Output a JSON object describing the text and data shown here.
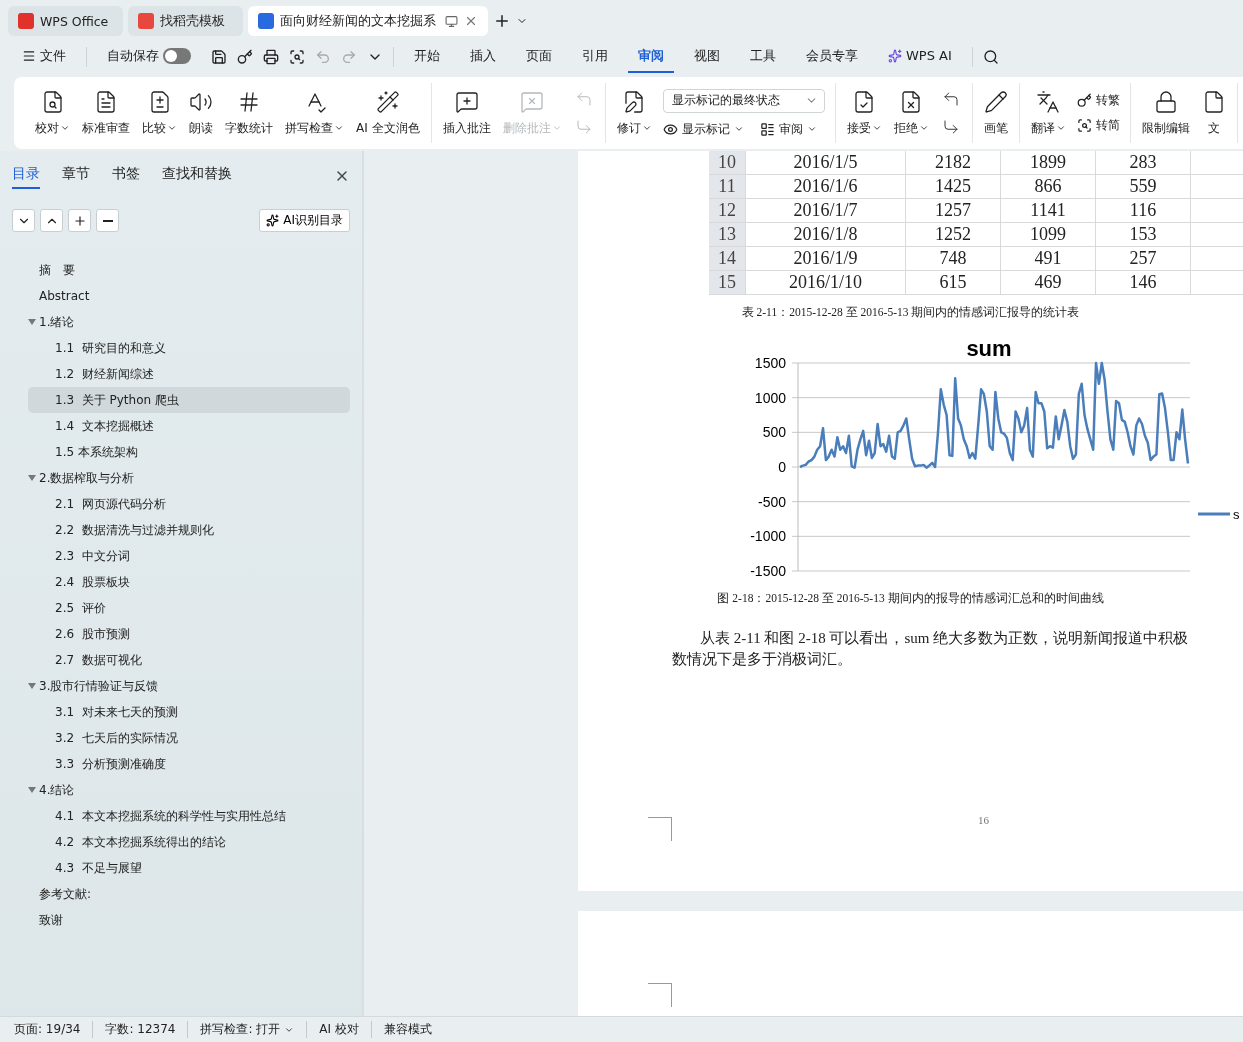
{
  "tabs": [
    {
      "kind": "wps",
      "label": "WPS Office",
      "selected": false
    },
    {
      "kind": "docer",
      "label": "找稻壳模板",
      "selected": false
    },
    {
      "kind": "doc",
      "label": "面向财经新闻的文本挖掘系",
      "selected": true
    }
  ],
  "menu": {
    "file": "文件",
    "autosave": {
      "label": "自动保存",
      "on": false
    },
    "items": [
      {
        "label": "开始",
        "selected": false
      },
      {
        "label": "插入",
        "selected": false
      },
      {
        "label": "页面",
        "selected": false
      },
      {
        "label": "引用",
        "selected": false
      },
      {
        "label": "审阅",
        "selected": true
      },
      {
        "label": "视图",
        "selected": false
      },
      {
        "label": "工具",
        "selected": false
      },
      {
        "label": "会员专享",
        "selected": false
      },
      {
        "label": "WPS AI",
        "selected": false,
        "kind": "ai"
      }
    ]
  },
  "ribbon": [
    {
      "items": [
        {
          "kind": "large",
          "label": "校对",
          "dropdown": true,
          "disabled": false
        },
        {
          "kind": "large",
          "label": "标准审查",
          "dropdown": false,
          "disabled": false
        },
        {
          "kind": "large",
          "label": "比较",
          "dropdown": true,
          "disabled": false
        },
        {
          "kind": "large",
          "label": "朗读",
          "dropdown": false,
          "disabled": false
        },
        {
          "kind": "large",
          "label": "字数统计",
          "dropdown": false,
          "disabled": false
        },
        {
          "kind": "large",
          "label": "拼写检查",
          "dropdown": true,
          "disabled": false
        },
        {
          "kind": "large",
          "label": "AI 全文润色",
          "dropdown": false,
          "disabled": false
        }
      ]
    },
    {
      "items": [
        {
          "kind": "large",
          "label": "插入批注",
          "dropdown": false,
          "disabled": false
        },
        {
          "kind": "large",
          "label": "删除批注",
          "dropdown": true,
          "disabled": true
        },
        {
          "kind": "pair",
          "disabled": true
        }
      ]
    },
    {
      "items": [
        {
          "kind": "large",
          "label": "修订",
          "dropdown": true,
          "disabled": false
        },
        {
          "kind": "select",
          "value": "显示标记的最终状态",
          "buttons": [
            {
              "label": "显示标记",
              "dropdown": true
            },
            {
              "label": "审阅",
              "dropdown": true
            }
          ]
        }
      ]
    },
    {
      "items": [
        {
          "kind": "large",
          "label": "接受",
          "dropdown": true,
          "disabled": false
        },
        {
          "kind": "large",
          "label": "拒绝",
          "dropdown": true,
          "disabled": false
        },
        {
          "kind": "pair",
          "disabled": false
        }
      ]
    },
    {
      "items": [
        {
          "kind": "large",
          "label": "画笔",
          "dropdown": false,
          "disabled": false
        }
      ]
    },
    {
      "items": [
        {
          "kind": "large",
          "label": "翻译",
          "dropdown": true,
          "disabled": false
        },
        {
          "kind": "stack",
          "buttons": [
            {
              "label": "转繁",
              "dropdown": false
            },
            {
              "label": "转简",
              "dropdown": false
            }
          ]
        }
      ]
    },
    {
      "items": [
        {
          "kind": "large",
          "label": "限制编辑",
          "dropdown": false,
          "disabled": false
        },
        {
          "kind": "large",
          "label": "文",
          "dropdown": false,
          "disabled": false
        }
      ]
    }
  ],
  "sidebar": {
    "tabs": [
      {
        "label": "目录",
        "selected": true
      },
      {
        "label": "章节",
        "selected": false
      },
      {
        "label": "书签",
        "selected": false
      },
      {
        "label": "查找和替换",
        "selected": false
      }
    ],
    "ai_button": "AI识别目录",
    "outline": [
      {
        "label": "摘　要",
        "selected": false
      },
      {
        "label": "Abstract",
        "selected": false
      },
      {
        "label": "1.绪论",
        "selected": false,
        "expanded": true,
        "children": [
          {
            "label": "1.1  研究目的和意义",
            "selected": false
          },
          {
            "label": "1.2  财经新闻综述",
            "selected": false
          },
          {
            "label": "1.3  关于 Python 爬虫",
            "selected": true
          },
          {
            "label": "1.4  文本挖掘概述",
            "selected": false
          },
          {
            "label": "1.5 本系统架构",
            "selected": false
          }
        ]
      },
      {
        "label": "2.数据榨取与分析",
        "selected": false,
        "expanded": true,
        "children": [
          {
            "label": "2.1  网页源代码分析",
            "selected": false
          },
          {
            "label": "2.2  数据清洗与过滤并规则化",
            "selected": false
          },
          {
            "label": "2.3  中文分词",
            "selected": false
          },
          {
            "label": "2.4  股票板块",
            "selected": false
          },
          {
            "label": "2.5  评价",
            "selected": false
          },
          {
            "label": "2.6  股市预测",
            "selected": false
          },
          {
            "label": "2.7  数据可视化",
            "selected": false
          }
        ]
      },
      {
        "label": "3.股市行情验证与反馈",
        "selected": false,
        "expanded": true,
        "children": [
          {
            "label": "3.1  对未来七天的预测",
            "selected": false
          },
          {
            "label": "3.2  七天后的实际情况",
            "selected": false
          },
          {
            "label": "3.3  分析预测准确度",
            "selected": false
          }
        ]
      },
      {
        "label": "4.结论",
        "selected": false,
        "expanded": true,
        "children": [
          {
            "label": "4.1  本文本挖掘系统的科学性与实用性总结",
            "selected": false
          },
          {
            "label": "4.2  本文本挖掘系统得出的结论",
            "selected": false
          },
          {
            "label": "4.3  不足与展望",
            "selected": false
          }
        ]
      },
      {
        "label": "参考文献:",
        "selected": false
      },
      {
        "label": "致谢",
        "selected": false
      }
    ]
  },
  "document": {
    "table": {
      "rows": [
        [
          "10",
          "2016/1/5",
          "2182",
          "1899",
          "283"
        ],
        [
          "11",
          "2016/1/6",
          "1425",
          "866",
          "559"
        ],
        [
          "12",
          "2016/1/7",
          "1257",
          "1141",
          "116"
        ],
        [
          "13",
          "2016/1/8",
          "1252",
          "1099",
          "153"
        ],
        [
          "14",
          "2016/1/9",
          "748",
          "491",
          "257"
        ],
        [
          "15",
          "2016/1/10",
          "615",
          "469",
          "146"
        ]
      ]
    },
    "table_caption": "表 2-11：2015-12-28 至 2016-5-13 期间内的情感词汇报导的统计表",
    "chart": {
      "chart_data": {
        "type": "line",
        "title": "sum",
        "ylim": [
          -1500,
          1500
        ],
        "yticks": [
          -1500,
          -1000,
          -500,
          0,
          500,
          1000,
          1500
        ],
        "grid": true,
        "series": [
          {
            "name": "s",
            "color": "#4a7ebb",
            "values": [
              0,
              20,
              30,
              80,
              100,
              150,
              250,
              300,
              560,
              100,
              150,
              250,
              150,
              430,
              250,
              300,
              200,
              450,
              10,
              -10,
              250,
              400,
              520,
              170,
              380,
              130,
              200,
              620,
              300,
              330,
              220,
              450,
              150,
              120,
              500,
              520,
              600,
              700,
              400,
              120,
              10,
              20,
              20,
              30,
              -10,
              20,
              60,
              0,
              500,
              1120,
              900,
              750,
              170,
              160,
              1280,
              700,
              600,
              400,
              300,
              130,
              200,
              120,
              600,
              1120,
              1050,
              800,
              300,
              250,
              1080,
              700,
              500,
              480,
              420,
              200,
              100,
              800,
              700,
              500,
              600,
              850,
              250,
              150,
              1080,
              920,
              920,
              800,
              270,
              300,
              280,
              730,
              400,
              600,
              820,
              650,
              300,
              120,
              180,
              1050,
              1200,
              750,
              550,
              400,
              250,
              1500,
              1200,
              1500,
              1250,
              800,
              400,
              250,
              950,
              920,
              680,
              650,
              500,
              300,
              180,
              600,
              700,
              620,
              450,
              350,
              100,
              150,
              180,
              1050,
              1060,
              850,
              500,
              100,
              100,
              500,
              400,
              830,
              400,
              50
            ]
          }
        ]
      }
    },
    "chart_caption": "图 2-18：2015-12-28 至 2016-5-13 期间内的报导的情感词汇总和的时间曲线",
    "paragraph": [
      "从表 2-11 和图 2-18 可以看出，sum 绝大多数为正数，说明新闻报道中积极",
      "数情况下是多于消极词汇。"
    ],
    "page_number": "16"
  },
  "status_bar": [
    {
      "label": "页面: 19/34",
      "dropdown": false
    },
    {
      "label": "字数: 12374",
      "dropdown": false
    },
    {
      "label": "拼写检查: 打开",
      "dropdown": true
    },
    {
      "label": "AI 校对",
      "dropdown": false
    },
    {
      "label": "兼容模式",
      "dropdown": false
    }
  ]
}
